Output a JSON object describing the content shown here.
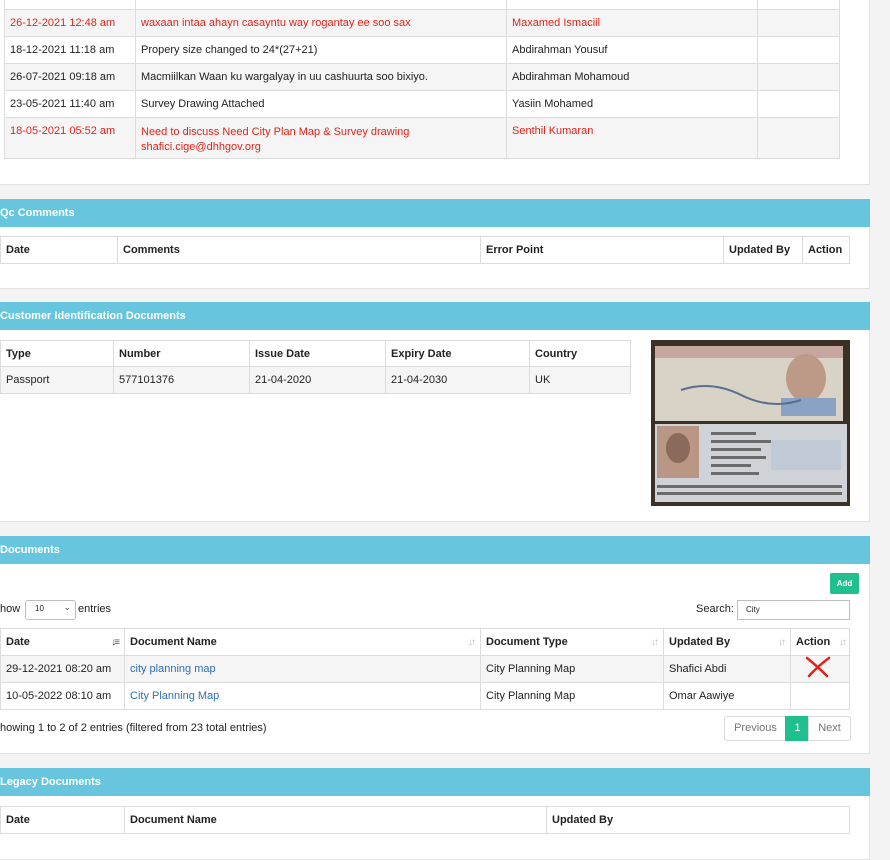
{
  "history": {
    "rows": [
      {
        "date": "26-12-2021 12:48 am",
        "comment": "waxaan intaa ahayn casayntu way rogantay ee soo sax",
        "by": "Maxamed Ismaciil",
        "highlight": true
      },
      {
        "date": "18-12-2021 11:18 am",
        "comment": "Propery size changed to 24*(27+21)",
        "by": "Abdirahman Yousuf",
        "highlight": false
      },
      {
        "date": "26-07-2021 09:18 am",
        "comment": "Macmiilkan Waan ku wargalyay in uu cashuurta soo bixiyo.",
        "by": "Abdirahman Mohamoud",
        "highlight": false
      },
      {
        "date": "23-05-2021 11:40 am",
        "comment": "Survey Drawing Attached",
        "by": "Yasiin Mohamed",
        "highlight": false
      },
      {
        "date": "18-05-2021 05:52 am",
        "comment": "Need to discuss Need City Plan Map & Survey drawing",
        "comment2": "shafici.cige@dhhgov.org",
        "by": "Senthil Kumaran",
        "highlight": true
      }
    ]
  },
  "qc": {
    "title": "Qc Comments",
    "cols": [
      "Date",
      "Comments",
      "Error Point",
      "Updated By",
      "Action"
    ]
  },
  "cid": {
    "title": "Customer Identification Documents",
    "cols": [
      "Type",
      "Number",
      "Issue Date",
      "Expiry Date",
      "Country"
    ],
    "row": [
      "Passport",
      "577101376",
      "21-04-2020",
      "21-04-2030",
      "UK"
    ],
    "image_label": "passport-photo"
  },
  "docs": {
    "title": "Documents",
    "add_label": "Add",
    "show_label": "how",
    "entries_label": "entries",
    "page_size": "10",
    "search_label": "Search:",
    "search_value": "City",
    "cols": [
      "Date",
      "Document Name",
      "Document Type",
      "Updated By",
      "Action"
    ],
    "rows": [
      {
        "date": "29-12-2021 08:20 am",
        "name": "city planning map",
        "type": "City Planning Map",
        "by": "Shafici Abdi",
        "x": true
      },
      {
        "date": "10-05-2022 08:10 am",
        "name": "City Planning Map",
        "type": "City Planning Map",
        "by": "Omar Aawiye",
        "x": false
      }
    ],
    "info": "howing 1 to 2 of 2 entries (filtered from 23 total entries)",
    "prev": "Previous",
    "page": "1",
    "next": "Next"
  },
  "legacy": {
    "title": "Legacy Documents",
    "cols": [
      "Date",
      "Document Name",
      "Updated By"
    ]
  },
  "colors": {
    "header": "#67c6de",
    "accent": "#1fbf8f",
    "alert": "#e2231a",
    "link": "#2f6fb5"
  }
}
